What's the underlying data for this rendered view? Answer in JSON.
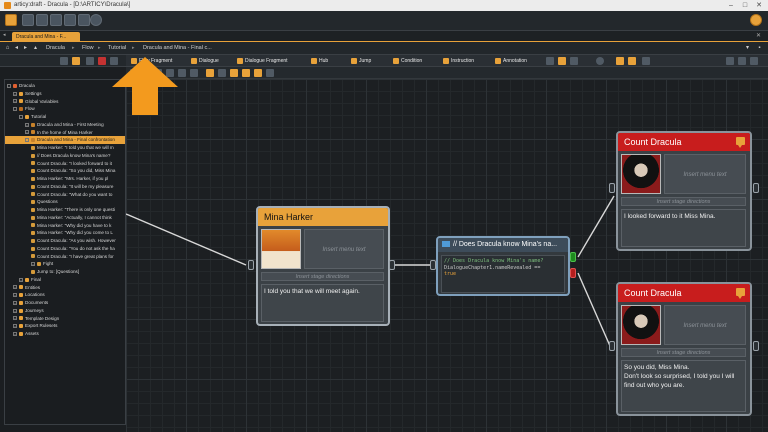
{
  "window": {
    "title": "articy:draft - Dracula - [D:\\ARTICY\\Dracula\\]"
  },
  "tab": {
    "label": "Dracula and Mina - F..."
  },
  "breadcrumb": [
    "Dracula",
    "Flow",
    "Tutorial",
    "Dracula and Mina - Final c..."
  ],
  "toolbox": [
    "Flow Fragment",
    "Dialogue",
    "Dialogue Fragment",
    "Hub",
    "Jump",
    "Condition",
    "Instruction",
    "Annotation"
  ],
  "tree": {
    "items": [
      {
        "label": "Dracula",
        "indent": 0,
        "icon": "root",
        "exp": "-"
      },
      {
        "label": "Settings",
        "indent": 1,
        "icon": "folder",
        "exp": "+"
      },
      {
        "label": "Global Variables",
        "indent": 1,
        "icon": "folder",
        "exp": "+"
      },
      {
        "label": "Flow",
        "indent": 1,
        "icon": "flow",
        "exp": "-"
      },
      {
        "label": "Tutorial",
        "indent": 2,
        "icon": "folder",
        "exp": "-"
      },
      {
        "label": "Dracula and Mina - First Meeting",
        "indent": 3,
        "icon": "frag",
        "exp": "+"
      },
      {
        "label": "In the home of Mina Harker",
        "indent": 3,
        "icon": "frag",
        "exp": "+"
      },
      {
        "label": "Dracula and Mina - Final confrontation",
        "indent": 3,
        "icon": "frag",
        "exp": "-",
        "selected": true
      },
      {
        "label": "Mina Harker: \"I told you that we will m",
        "indent": 4,
        "icon": "dlg"
      },
      {
        "label": "// Does Dracula know Mina's name?",
        "indent": 4,
        "icon": "dlg"
      },
      {
        "label": "Count Dracula: \"I looked forward to it",
        "indent": 4,
        "icon": "dlg"
      },
      {
        "label": "Count Dracula: \"So you did, Miss Mina",
        "indent": 4,
        "icon": "dlg"
      },
      {
        "label": "Mina Harker: \"Mrs. Harker, if you pl",
        "indent": 4,
        "icon": "dlg"
      },
      {
        "label": "Count Dracula: \"It will be my pleasure",
        "indent": 4,
        "icon": "dlg"
      },
      {
        "label": "Count Dracula: \"What do you want to",
        "indent": 4,
        "icon": "dlg"
      },
      {
        "label": "Questions",
        "indent": 4,
        "icon": "dlg"
      },
      {
        "label": "Mina Harker: \"There is only one questi",
        "indent": 4,
        "icon": "dlg"
      },
      {
        "label": "Mina Harker: \"Actually, I cannot think",
        "indent": 4,
        "icon": "dlg"
      },
      {
        "label": "Mina Harker: \"Why did you have to k",
        "indent": 4,
        "icon": "dlg"
      },
      {
        "label": "Mina Harker: \"Why did you come to L",
        "indent": 4,
        "icon": "dlg"
      },
      {
        "label": "Count Dracula: \"As you wish. However",
        "indent": 4,
        "icon": "dlg"
      },
      {
        "label": "Count Dracula: \"You do not ask the ha",
        "indent": 4,
        "icon": "dlg"
      },
      {
        "label": "Count Dracula: \"I have great plans for",
        "indent": 4,
        "icon": "dlg"
      },
      {
        "label": "Fight",
        "indent": 4,
        "icon": "dlg",
        "exp": "+"
      },
      {
        "label": "Jump to: [Questions]",
        "indent": 4,
        "icon": "dlg"
      },
      {
        "label": "Final",
        "indent": 2,
        "icon": "folder",
        "exp": "+"
      },
      {
        "label": "Entities",
        "indent": 1,
        "icon": "folder",
        "exp": "+"
      },
      {
        "label": "Locations",
        "indent": 1,
        "icon": "folder",
        "exp": "+"
      },
      {
        "label": "Documents",
        "indent": 1,
        "icon": "folder",
        "exp": "+"
      },
      {
        "label": "Journeys",
        "indent": 1,
        "icon": "folder",
        "exp": "+"
      },
      {
        "label": "Template Design",
        "indent": 1,
        "icon": "folder",
        "exp": "+"
      },
      {
        "label": "Export Rulesets",
        "indent": 1,
        "icon": "folder",
        "exp": "+"
      },
      {
        "label": "Assets",
        "indent": 1,
        "icon": "folder",
        "exp": "+"
      }
    ]
  },
  "nodes": {
    "mina": {
      "speaker": "Mina Harker",
      "menu_placeholder": "Insert menu text",
      "stage_placeholder": "Insert stage directions",
      "text": "I told you that we will meet again.",
      "color": "#e8a23a"
    },
    "condition": {
      "title": "// Does Dracula know Mina's na...",
      "code_comment": "// Does Dracula know Mina's name?",
      "code_expr": "DialogueChapter1.nameRevealed ==",
      "code_value": "true"
    },
    "dracula1": {
      "speaker": "Count Dracula",
      "menu_placeholder": "Insert menu text",
      "stage_placeholder": "Insert stage directions",
      "text": "I looked forward to it Miss Mina.",
      "color": "#c81d1d"
    },
    "dracula2": {
      "speaker": "Count Dracula",
      "menu_placeholder": "Insert menu text",
      "stage_placeholder": "Insert stage directions",
      "text": "So you did, Miss Mina.\nDon't look so surprised, I told you I will find out who you are.",
      "color": "#c81d1d"
    }
  },
  "colors": {
    "accent": "#e8a23a",
    "dracula_header": "#c81d1d",
    "true_pin": "#1e8a1e",
    "false_pin": "#b51e1e"
  }
}
